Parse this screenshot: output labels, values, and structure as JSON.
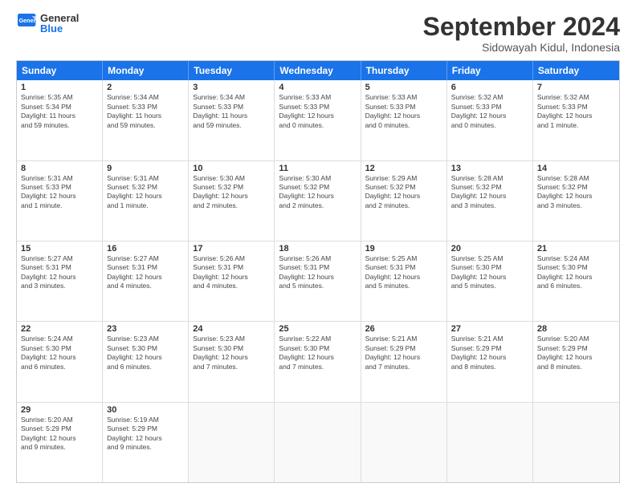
{
  "logo": {
    "text_general": "General",
    "text_blue": "Blue"
  },
  "header": {
    "month_year": "September 2024",
    "location": "Sidowayah Kidul, Indonesia"
  },
  "weekdays": [
    "Sunday",
    "Monday",
    "Tuesday",
    "Wednesday",
    "Thursday",
    "Friday",
    "Saturday"
  ],
  "rows": [
    [
      {
        "day": "1",
        "lines": [
          "Sunrise: 5:35 AM",
          "Sunset: 5:34 PM",
          "Daylight: 11 hours",
          "and 59 minutes."
        ]
      },
      {
        "day": "2",
        "lines": [
          "Sunrise: 5:34 AM",
          "Sunset: 5:33 PM",
          "Daylight: 11 hours",
          "and 59 minutes."
        ]
      },
      {
        "day": "3",
        "lines": [
          "Sunrise: 5:34 AM",
          "Sunset: 5:33 PM",
          "Daylight: 11 hours",
          "and 59 minutes."
        ]
      },
      {
        "day": "4",
        "lines": [
          "Sunrise: 5:33 AM",
          "Sunset: 5:33 PM",
          "Daylight: 12 hours",
          "and 0 minutes."
        ]
      },
      {
        "day": "5",
        "lines": [
          "Sunrise: 5:33 AM",
          "Sunset: 5:33 PM",
          "Daylight: 12 hours",
          "and 0 minutes."
        ]
      },
      {
        "day": "6",
        "lines": [
          "Sunrise: 5:32 AM",
          "Sunset: 5:33 PM",
          "Daylight: 12 hours",
          "and 0 minutes."
        ]
      },
      {
        "day": "7",
        "lines": [
          "Sunrise: 5:32 AM",
          "Sunset: 5:33 PM",
          "Daylight: 12 hours",
          "and 1 minute."
        ]
      }
    ],
    [
      {
        "day": "8",
        "lines": [
          "Sunrise: 5:31 AM",
          "Sunset: 5:33 PM",
          "Daylight: 12 hours",
          "and 1 minute."
        ]
      },
      {
        "day": "9",
        "lines": [
          "Sunrise: 5:31 AM",
          "Sunset: 5:32 PM",
          "Daylight: 12 hours",
          "and 1 minute."
        ]
      },
      {
        "day": "10",
        "lines": [
          "Sunrise: 5:30 AM",
          "Sunset: 5:32 PM",
          "Daylight: 12 hours",
          "and 2 minutes."
        ]
      },
      {
        "day": "11",
        "lines": [
          "Sunrise: 5:30 AM",
          "Sunset: 5:32 PM",
          "Daylight: 12 hours",
          "and 2 minutes."
        ]
      },
      {
        "day": "12",
        "lines": [
          "Sunrise: 5:29 AM",
          "Sunset: 5:32 PM",
          "Daylight: 12 hours",
          "and 2 minutes."
        ]
      },
      {
        "day": "13",
        "lines": [
          "Sunrise: 5:28 AM",
          "Sunset: 5:32 PM",
          "Daylight: 12 hours",
          "and 3 minutes."
        ]
      },
      {
        "day": "14",
        "lines": [
          "Sunrise: 5:28 AM",
          "Sunset: 5:32 PM",
          "Daylight: 12 hours",
          "and 3 minutes."
        ]
      }
    ],
    [
      {
        "day": "15",
        "lines": [
          "Sunrise: 5:27 AM",
          "Sunset: 5:31 PM",
          "Daylight: 12 hours",
          "and 3 minutes."
        ]
      },
      {
        "day": "16",
        "lines": [
          "Sunrise: 5:27 AM",
          "Sunset: 5:31 PM",
          "Daylight: 12 hours",
          "and 4 minutes."
        ]
      },
      {
        "day": "17",
        "lines": [
          "Sunrise: 5:26 AM",
          "Sunset: 5:31 PM",
          "Daylight: 12 hours",
          "and 4 minutes."
        ]
      },
      {
        "day": "18",
        "lines": [
          "Sunrise: 5:26 AM",
          "Sunset: 5:31 PM",
          "Daylight: 12 hours",
          "and 5 minutes."
        ]
      },
      {
        "day": "19",
        "lines": [
          "Sunrise: 5:25 AM",
          "Sunset: 5:31 PM",
          "Daylight: 12 hours",
          "and 5 minutes."
        ]
      },
      {
        "day": "20",
        "lines": [
          "Sunrise: 5:25 AM",
          "Sunset: 5:30 PM",
          "Daylight: 12 hours",
          "and 5 minutes."
        ]
      },
      {
        "day": "21",
        "lines": [
          "Sunrise: 5:24 AM",
          "Sunset: 5:30 PM",
          "Daylight: 12 hours",
          "and 6 minutes."
        ]
      }
    ],
    [
      {
        "day": "22",
        "lines": [
          "Sunrise: 5:24 AM",
          "Sunset: 5:30 PM",
          "Daylight: 12 hours",
          "and 6 minutes."
        ]
      },
      {
        "day": "23",
        "lines": [
          "Sunrise: 5:23 AM",
          "Sunset: 5:30 PM",
          "Daylight: 12 hours",
          "and 6 minutes."
        ]
      },
      {
        "day": "24",
        "lines": [
          "Sunrise: 5:23 AM",
          "Sunset: 5:30 PM",
          "Daylight: 12 hours",
          "and 7 minutes."
        ]
      },
      {
        "day": "25",
        "lines": [
          "Sunrise: 5:22 AM",
          "Sunset: 5:30 PM",
          "Daylight: 12 hours",
          "and 7 minutes."
        ]
      },
      {
        "day": "26",
        "lines": [
          "Sunrise: 5:21 AM",
          "Sunset: 5:29 PM",
          "Daylight: 12 hours",
          "and 7 minutes."
        ]
      },
      {
        "day": "27",
        "lines": [
          "Sunrise: 5:21 AM",
          "Sunset: 5:29 PM",
          "Daylight: 12 hours",
          "and 8 minutes."
        ]
      },
      {
        "day": "28",
        "lines": [
          "Sunrise: 5:20 AM",
          "Sunset: 5:29 PM",
          "Daylight: 12 hours",
          "and 8 minutes."
        ]
      }
    ],
    [
      {
        "day": "29",
        "lines": [
          "Sunrise: 5:20 AM",
          "Sunset: 5:29 PM",
          "Daylight: 12 hours",
          "and 9 minutes."
        ]
      },
      {
        "day": "30",
        "lines": [
          "Sunrise: 5:19 AM",
          "Sunset: 5:29 PM",
          "Daylight: 12 hours",
          "and 9 minutes."
        ]
      },
      {
        "day": "",
        "lines": []
      },
      {
        "day": "",
        "lines": []
      },
      {
        "day": "",
        "lines": []
      },
      {
        "day": "",
        "lines": []
      },
      {
        "day": "",
        "lines": []
      }
    ]
  ]
}
